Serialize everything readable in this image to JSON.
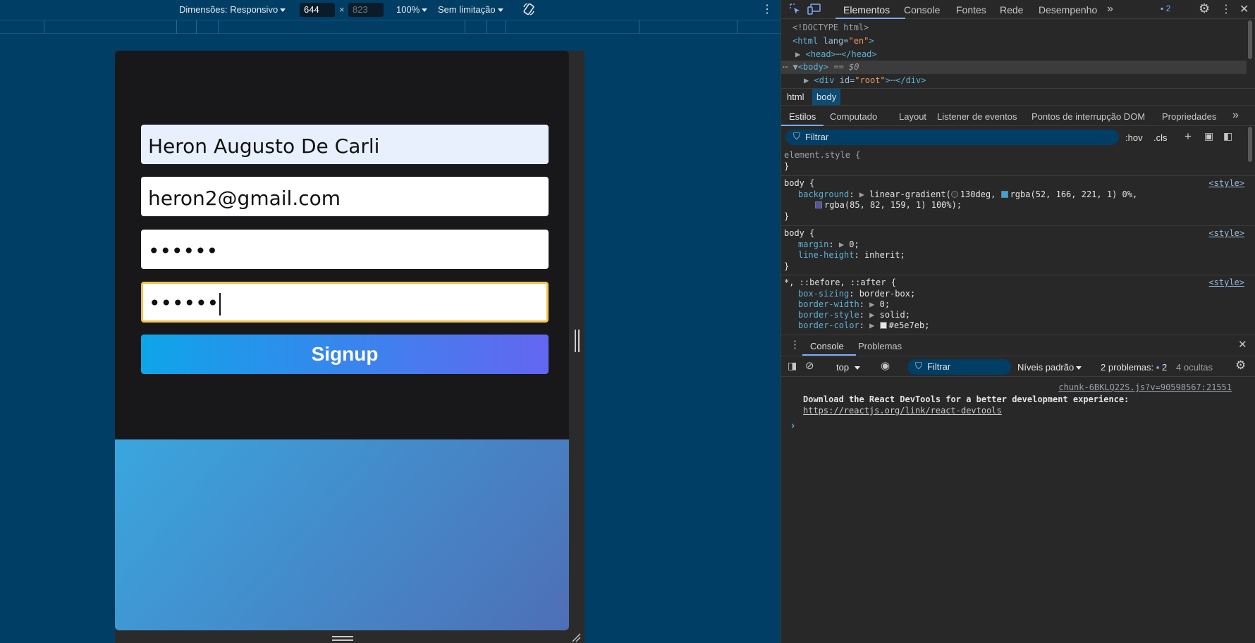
{
  "device_toolbar": {
    "dimensions_label": "Dimensões: Responsivo",
    "width": "644",
    "times": "×",
    "height": "823",
    "zoom": "100%",
    "throttle": "Sem limitação"
  },
  "form": {
    "name_value": "Heron Augusto De Carli",
    "email_value": "heron2@gmail.com",
    "password_value": "••••••",
    "confirm_value": "••••••",
    "signup_label": "Signup"
  },
  "devtools": {
    "tabs": [
      "Elementos",
      "Console",
      "Fontes",
      "Rede",
      "Desempenho"
    ],
    "issues_count": "2",
    "dom": {
      "doctype": "<!DOCTYPE html>",
      "html_open": "<html",
      "lang_attr": "lang=",
      "lang_val": "\"en\"",
      "head": "<head>",
      "head_close": "</head>",
      "body": "<body>",
      "body_eq": "== $0",
      "div_open": "<div",
      "id_attr": "id=",
      "id_val": "\"root\"",
      "div_close": "</div>"
    },
    "breadcrumbs": [
      "html",
      "body"
    ],
    "style_tabs": [
      "Estilos",
      "Computado",
      "Layout",
      "Listener de eventos",
      "Pontos de interrupção DOM",
      "Propriedades"
    ],
    "filter_placeholder": "Filtrar",
    "hov": ":hov",
    "cls": ".cls",
    "rules": {
      "element_style": "element.style {",
      "close": "}",
      "body_sel": "body {",
      "background_prop": "background",
      "background_val1": "linear-gradient(",
      "deg": "130deg,",
      "rgba1": "rgba(52, 166, 221, 1) 0%,",
      "rgba2": "rgba(85, 82, 159, 1) 100%);",
      "margin_prop": "margin",
      "margin_val": "0;",
      "lh_prop": "line-height",
      "lh_val": "inherit;",
      "univ_sel": "*, ::before, ::after {",
      "bs_prop": "box-sizing",
      "bs_val": "border-box;",
      "bw_prop": "border-width",
      "bw_val": "0;",
      "bst_prop": "border-style",
      "bst_val": "solid;",
      "bc_prop": "border-color",
      "bc_val": "#e5e7eb;",
      "source": "<style>",
      "swatch1": "#34a6dd",
      "swatch2": "#55529f",
      "swatch3": "#e5e7eb"
    },
    "drawer_tabs": [
      "Console",
      "Problemas"
    ],
    "console_context": "top",
    "console_filter": "Filtrar",
    "levels": "Níveis padrão",
    "problems": "2 problemas:",
    "problems_count": "2",
    "hidden": "4 ocultas",
    "message_source": "chunk-6BKLQ22S.js?v=90598567:21551",
    "message_text": "Download the React DevTools for a better development experience:",
    "message_link": "https://reactjs.org/link/react-devtools",
    "prompt": "›"
  }
}
